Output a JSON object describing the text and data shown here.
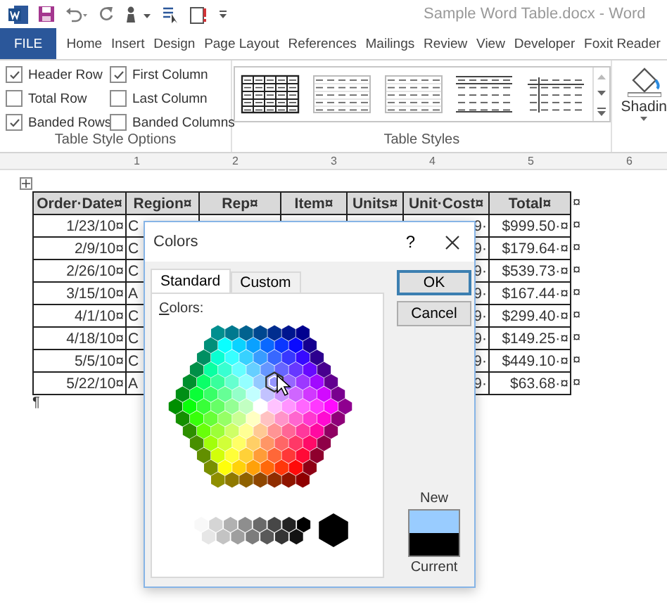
{
  "title_bar": {
    "title": "Sample Word Table.docx - Word"
  },
  "ribbon_tabs": [
    {
      "label": "FILE",
      "kind": "file"
    },
    {
      "label": "Home",
      "kind": "tab"
    },
    {
      "label": "Insert",
      "kind": "tab"
    },
    {
      "label": "Design",
      "kind": "tab"
    },
    {
      "label": "Page Layout",
      "kind": "tab"
    },
    {
      "label": "References",
      "kind": "tab"
    },
    {
      "label": "Mailings",
      "kind": "tab"
    },
    {
      "label": "Review",
      "kind": "tab"
    },
    {
      "label": "View",
      "kind": "tab"
    },
    {
      "label": "Developer",
      "kind": "tab"
    },
    {
      "label": "Foxit Reader",
      "kind": "tab"
    }
  ],
  "table_style_options": {
    "options": [
      {
        "label": "Header Row",
        "checked": true
      },
      {
        "label": "First Column",
        "checked": true
      },
      {
        "label": "Total Row",
        "checked": false
      },
      {
        "label": "Last Column",
        "checked": false
      },
      {
        "label": "Banded Rows",
        "checked": true
      },
      {
        "label": "Banded Columns",
        "checked": false
      }
    ],
    "group_label": "Table Style Options"
  },
  "table_styles": {
    "styles": [
      {
        "kind": "grid"
      },
      {
        "kind": "light-grid"
      },
      {
        "kind": "light-grid"
      },
      {
        "kind": "lines"
      },
      {
        "kind": "first-column"
      }
    ],
    "group_label": "Table Styles"
  },
  "shading": {
    "label": "Shadin"
  },
  "ruler": {
    "numbers": [
      "1",
      "2",
      "3",
      "4",
      "5",
      "6"
    ]
  },
  "table": {
    "columns": [
      "Order·Date¤",
      "Region¤",
      "Rep¤",
      "Item¤",
      "Units¤",
      "Unit·Cost¤",
      "Total¤"
    ],
    "header_end_mark": "¤",
    "rows": [
      {
        "order_date": "1/23/10¤",
        "region": "C",
        "unit_cost": "9·",
        "total": "$999.50·¤",
        "end_mark": "¤"
      },
      {
        "order_date": "2/9/10¤",
        "region": "C",
        "unit_cost": "9·",
        "total": "$179.64·¤",
        "end_mark": "¤"
      },
      {
        "order_date": "2/26/10¤",
        "region": "C",
        "unit_cost": "9·",
        "total": "$539.73·¤",
        "end_mark": "¤"
      },
      {
        "order_date": "3/15/10¤",
        "region": "A",
        "unit_cost": "9·",
        "total": "$167.44·¤",
        "end_mark": "¤"
      },
      {
        "order_date": "4/1/10¤",
        "region": "C",
        "unit_cost": "9·",
        "total": "$299.40·¤",
        "end_mark": "¤"
      },
      {
        "order_date": "4/18/10¤",
        "region": "C",
        "unit_cost": "9·",
        "total": "$149.25·¤",
        "end_mark": "¤"
      },
      {
        "order_date": "5/5/10¤",
        "region": "C",
        "unit_cost": "9·",
        "total": "$449.10·¤",
        "end_mark": "¤"
      },
      {
        "order_date": "5/22/10¤",
        "region": "A",
        "unit_cost": "9·",
        "total": "$63.68·¤",
        "end_mark": "¤"
      }
    ]
  },
  "paragraph_mark": "¶",
  "dialog": {
    "title": "Colors",
    "help": "?",
    "tabs": [
      {
        "label": "Standard",
        "selected": true
      },
      {
        "label": "Custom",
        "selected": false
      }
    ],
    "colors_label": "Colors:",
    "buttons": [
      {
        "label": "OK",
        "kind": "default"
      },
      {
        "label": "Cancel",
        "kind": "normal"
      }
    ],
    "swatches": [
      {
        "label": "New",
        "color": "#99ccff"
      },
      {
        "label": "Current",
        "color": "#000000"
      }
    ]
  }
}
